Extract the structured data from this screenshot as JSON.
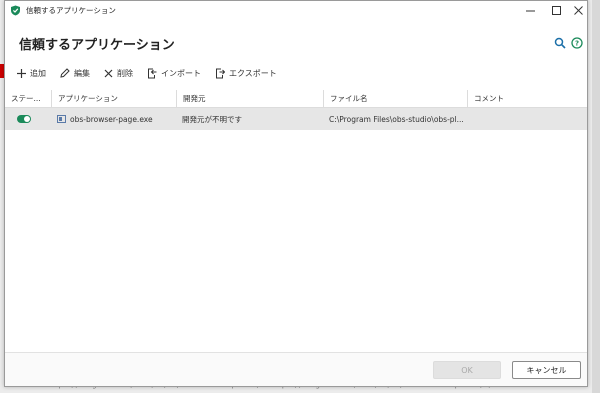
{
  "window": {
    "title": "信頼するアプリケーション"
  },
  "header": {
    "title": "信頼するアプリケーション"
  },
  "toolbar": {
    "add": "追加",
    "edit": "編集",
    "delete": "削除",
    "import": "インポート",
    "export": "エクスポート"
  },
  "table": {
    "columns": [
      "ステー...",
      "アプリケーション",
      "開発元",
      "ファイル名",
      "コメント"
    ],
    "rows": [
      {
        "status": "on",
        "application": "obs-browser-page.exe",
        "developer": "開発元が不明です",
        "file": "C:\\Program Files\\obs-studio\\obs-pl...",
        "comment": ""
      }
    ]
  },
  "footer": {
    "ok": "OK",
    "cancel": "キャンセル"
  },
  "background_text": "<a href=\"https://blogmemo.net/2021/06/25/windows-11-tpm-2-0/\">https://blogmemo.net/2021/06/25/windows-11-tpm-2-0/</a>",
  "colors": {
    "toggle_on": "#1b8a5a",
    "accent_icon": "#1b6fa8",
    "shield": "#1b8a5a"
  }
}
